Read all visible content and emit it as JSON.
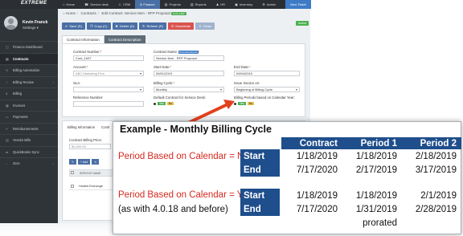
{
  "app": {
    "logo": "EXTREME",
    "topnav": [
      {
        "label": "Home",
        "icon": "home-icon",
        "active": false
      },
      {
        "label": "Service desk",
        "icon": "headset-icon",
        "active": false
      },
      {
        "label": "CRM",
        "icon": "users-icon",
        "active": false
      },
      {
        "label": "Finance",
        "icon": "dollar-icon",
        "active": true
      },
      {
        "label": "Projects",
        "icon": "folder-icon",
        "active": false
      },
      {
        "label": "Reports",
        "icon": "chart-icon",
        "active": false
      },
      {
        "label": "HR",
        "icon": "person-icon",
        "active": false
      },
      {
        "label": "Inventory",
        "icon": "box-icon",
        "active": false
      },
      {
        "label": "Admin",
        "icon": "gear-icon",
        "active": false
      }
    ],
    "new_ticket": "New Ticket",
    "user": {
      "name": "Kevin Franck",
      "settings": "Settings ▾"
    },
    "sidebar": [
      {
        "label": "Finance Dashboard",
        "icon": "dashboard-icon",
        "active": false,
        "chev": false
      },
      {
        "label": "Contracts",
        "icon": "document-icon",
        "active": true,
        "chev": false
      },
      {
        "label": "Billing Automation",
        "icon": "refresh-icon",
        "active": false,
        "chev": false
      },
      {
        "label": "Billing Review",
        "icon": "check-icon",
        "active": false,
        "chev": true
      },
      {
        "label": "Billing",
        "icon": "money-icon",
        "active": false,
        "chev": false
      },
      {
        "label": "Invoices",
        "icon": "invoice-icon",
        "active": false,
        "chev": false
      },
      {
        "label": "Payments",
        "icon": "card-icon",
        "active": false,
        "chev": false
      },
      {
        "label": "Reimbursements",
        "icon": "return-icon",
        "active": false,
        "chev": false
      },
      {
        "label": "Vendor Bills",
        "icon": "bill-icon",
        "active": false,
        "chev": false
      },
      {
        "label": "QuickBooks Sync",
        "icon": "sync-icon",
        "active": false,
        "chev": false
      },
      {
        "label": "Zero",
        "icon": "zero-icon",
        "active": false,
        "chev": true
      }
    ],
    "breadcrumb": {
      "home": "Home",
      "contracts": "Contracts",
      "current": "Edit Contract: Service Item - RFP Proposal",
      "badge": "Cont_1637"
    },
    "status": "Active",
    "toolbar": {
      "save": "Save (S)",
      "copy": "Copy (C)",
      "delete": "Delete (D)",
      "refresh": "Refresh (R)",
      "deactivate": "Deactivate",
      "close": "Close"
    },
    "tabs": {
      "info": "Contract Information",
      "description": "Contract Description"
    },
    "form": {
      "contract_number_label": "Contract Number:",
      "contract_number_value": "Cont_1637",
      "contract_name_label": "Contract Name:",
      "contract_name_badge": "Recurring Service",
      "contract_name_value": "Service Item - RFP Proposal",
      "account_label": "Account:",
      "account_value": "ABC Marketing Firm",
      "start_date_label": "Start Date:",
      "start_date_value": "09/01/2019",
      "end_date_label": "End Date:",
      "end_date_value": "09/04/2019",
      "sla_label": "SLA:",
      "billing_cycle_label": "Billing Cycle:",
      "billing_cycle_value": "Monthly",
      "issue_invoice_label": "Issue Invoice on:",
      "issue_invoice_value": "Beginning of Billing Cycle",
      "reference_label": "Reference Number:",
      "default_contract_label": "Default Contract for Service Desk:",
      "billing_periods_label": "Billing Periods based on Calendar Year:",
      "yes": "Yes",
      "no": "No"
    },
    "billing": {
      "tab_info": "Billing Information",
      "tab_other": "Contr",
      "price_label": "Contract Billing Price:",
      "price_value": "$1,000.00",
      "add_label": "Add",
      "col_service_name": "SERVICE NAME",
      "row1": "Hosted Exchange"
    }
  },
  "example": {
    "title": "Example - Monthly Billing Cycle",
    "columns": [
      "Contract",
      "Period 1",
      "Period 2"
    ],
    "case1": {
      "label": "Period Based on Calendar = NO",
      "rows": [
        {
          "label": "Start",
          "values": [
            "1/18/2019",
            "1/18/2019",
            "2/18/2019"
          ]
        },
        {
          "label": "End",
          "values": [
            "7/17/2020",
            "2/17/2019",
            "3/17/2019"
          ]
        }
      ]
    },
    "case2": {
      "label": "Period Based on Calendar = YES",
      "sublabel": "(as with 4.0.18 and before)",
      "rows": [
        {
          "label": "Start",
          "values": [
            "1/18/2019",
            "1/18/2019",
            "2/1/2019"
          ]
        },
        {
          "label": "End",
          "values": [
            "7/17/2020",
            "1/31/2019",
            "2/28/2019"
          ]
        }
      ],
      "note": "prorated"
    },
    "colors": {
      "header": "#1f4e8c",
      "red_text": "#d42a1f",
      "arrow": "#e2401c"
    }
  }
}
